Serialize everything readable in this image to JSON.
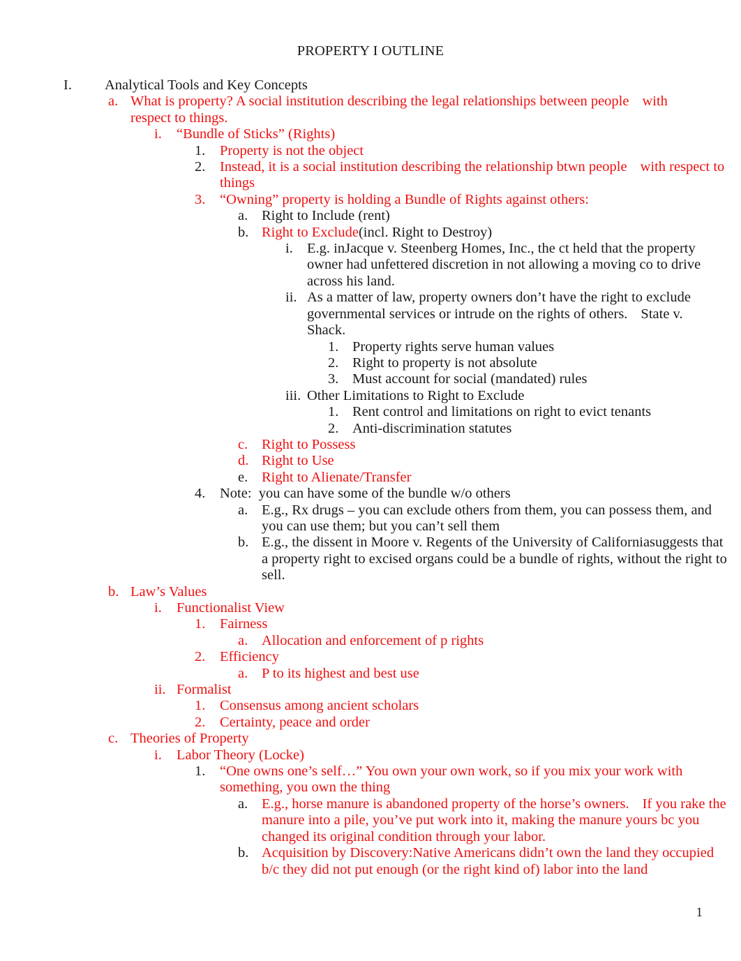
{
  "document": {
    "title": "PROPERTY I OUTLINE",
    "page_number": "1",
    "colors": {
      "red": "#EE1111",
      "black": "#1A1A1A",
      "background": "#FFFFFF"
    }
  },
  "outline": {
    "i_heading": {
      "marker": "I.",
      "text": "Analytical Tools and Key Concepts"
    },
    "a_what_is_property": {
      "marker": "a.",
      "text_part1": "What is property? A social institution describing the legal relationships between people",
      "text_part2": "with respect to things."
    },
    "bundle_of_sticks": {
      "marker": "i.",
      "text": "“Bundle of Sticks” (Rights)"
    },
    "bos_1": {
      "marker": "1.",
      "text": "Property is not the object"
    },
    "bos_2": {
      "marker": "2.",
      "text_part1": "Instead, it is a social institution describing the relationship btwn people",
      "text_part2": "with respect to things"
    },
    "bos_3": {
      "marker": "3.",
      "text": "“Owning” property is holding a Bundle of Rights against others:"
    },
    "right_include": {
      "marker": "a.",
      "text": "Right to Include (rent)"
    },
    "right_exclude": {
      "marker": "b.",
      "text_red": "Right to Exclude",
      "text_black": "(incl. Right to Destroy)"
    },
    "exclude_i": {
      "marker": "i.",
      "text": "E.g. inJacque v. Steenberg Homes, Inc., the ct held that the property owner had unfettered discretion in not allowing a moving co to drive across his land."
    },
    "exclude_ii": {
      "marker": "ii.",
      "text_part1": "As a matter of law, property owners don’t have the right to exclude governmental services or intrude on the rights of others.",
      "text_part2": "State v. Shack."
    },
    "exclude_ii_1": {
      "marker": "1.",
      "text": "Property rights serve human values"
    },
    "exclude_ii_2": {
      "marker": "2.",
      "text": "Right to property is not absolute"
    },
    "exclude_ii_3": {
      "marker": "3.",
      "text": "Must account for social (mandated) rules"
    },
    "exclude_iii": {
      "marker": "iii.",
      "text": "Other Limitations to Right to Exclude"
    },
    "exclude_iii_1": {
      "marker": "1.",
      "text": "Rent control and limitations on right to evict tenants"
    },
    "exclude_iii_2": {
      "marker": "2.",
      "text": "Anti-discrimination statutes"
    },
    "right_possess": {
      "marker": "c.",
      "text": "Right to Possess"
    },
    "right_use": {
      "marker": "d.",
      "text": "Right to Use"
    },
    "right_alienate": {
      "marker": "e.",
      "text": "Right to Alienate/Transfer"
    },
    "note_4": {
      "marker": "4.",
      "text": "Note:  you can have some of the bundle w/o others"
    },
    "note_4a": {
      "marker": "a.",
      "text": "E.g., Rx drugs – you can exclude others from them, you can possess them, and you can use them; but you can’t sell them"
    },
    "note_4b": {
      "marker": "b.",
      "text": "E.g., the dissent in Moore v. Regents of the University of Californiasuggests that a property right to excised organs could be a bundle of rights, without the right to sell."
    },
    "b_laws_values": {
      "marker": "b.",
      "text": "Law’s Values"
    },
    "functionalist": {
      "marker": "i.",
      "text": "Functionalist View"
    },
    "fairness": {
      "marker": "1.",
      "text": "Fairness"
    },
    "fairness_a": {
      "marker": "a.",
      "text": "Allocation and enforcement of p rights"
    },
    "efficiency": {
      "marker": "2.",
      "text": "Efficiency"
    },
    "efficiency_a": {
      "marker": "a.",
      "text": "P to its highest and best use"
    },
    "formalist": {
      "marker": "ii.",
      "text": "Formalist"
    },
    "formalist_1": {
      "marker": "1.",
      "text": "Consensus among ancient scholars"
    },
    "formalist_2": {
      "marker": "2.",
      "text": "Certainty, peace and order"
    },
    "c_theories": {
      "marker": "c.",
      "text": "Theories of Property"
    },
    "labor_theory": {
      "marker": "i.",
      "text": "Labor Theory (Locke)"
    },
    "labor_1": {
      "marker": "1.",
      "text": "“One owns one’s self…” You own your own work, so if you mix your work with something, you own the thing"
    },
    "labor_1a": {
      "marker": "a.",
      "text_part1": "E.g., horse manure is abandoned property of the horse’s owners.",
      "text_part2": "If you rake the manure into a pile, you’ve put work into it, making the manure yours bc you changed its original condition through your labor."
    },
    "labor_1b": {
      "marker": "b.",
      "text": "Acquisition by Discovery:Native Americans didn’t own the land they occupied b/c they did not put enough (or the right kind of) labor into the land"
    }
  }
}
